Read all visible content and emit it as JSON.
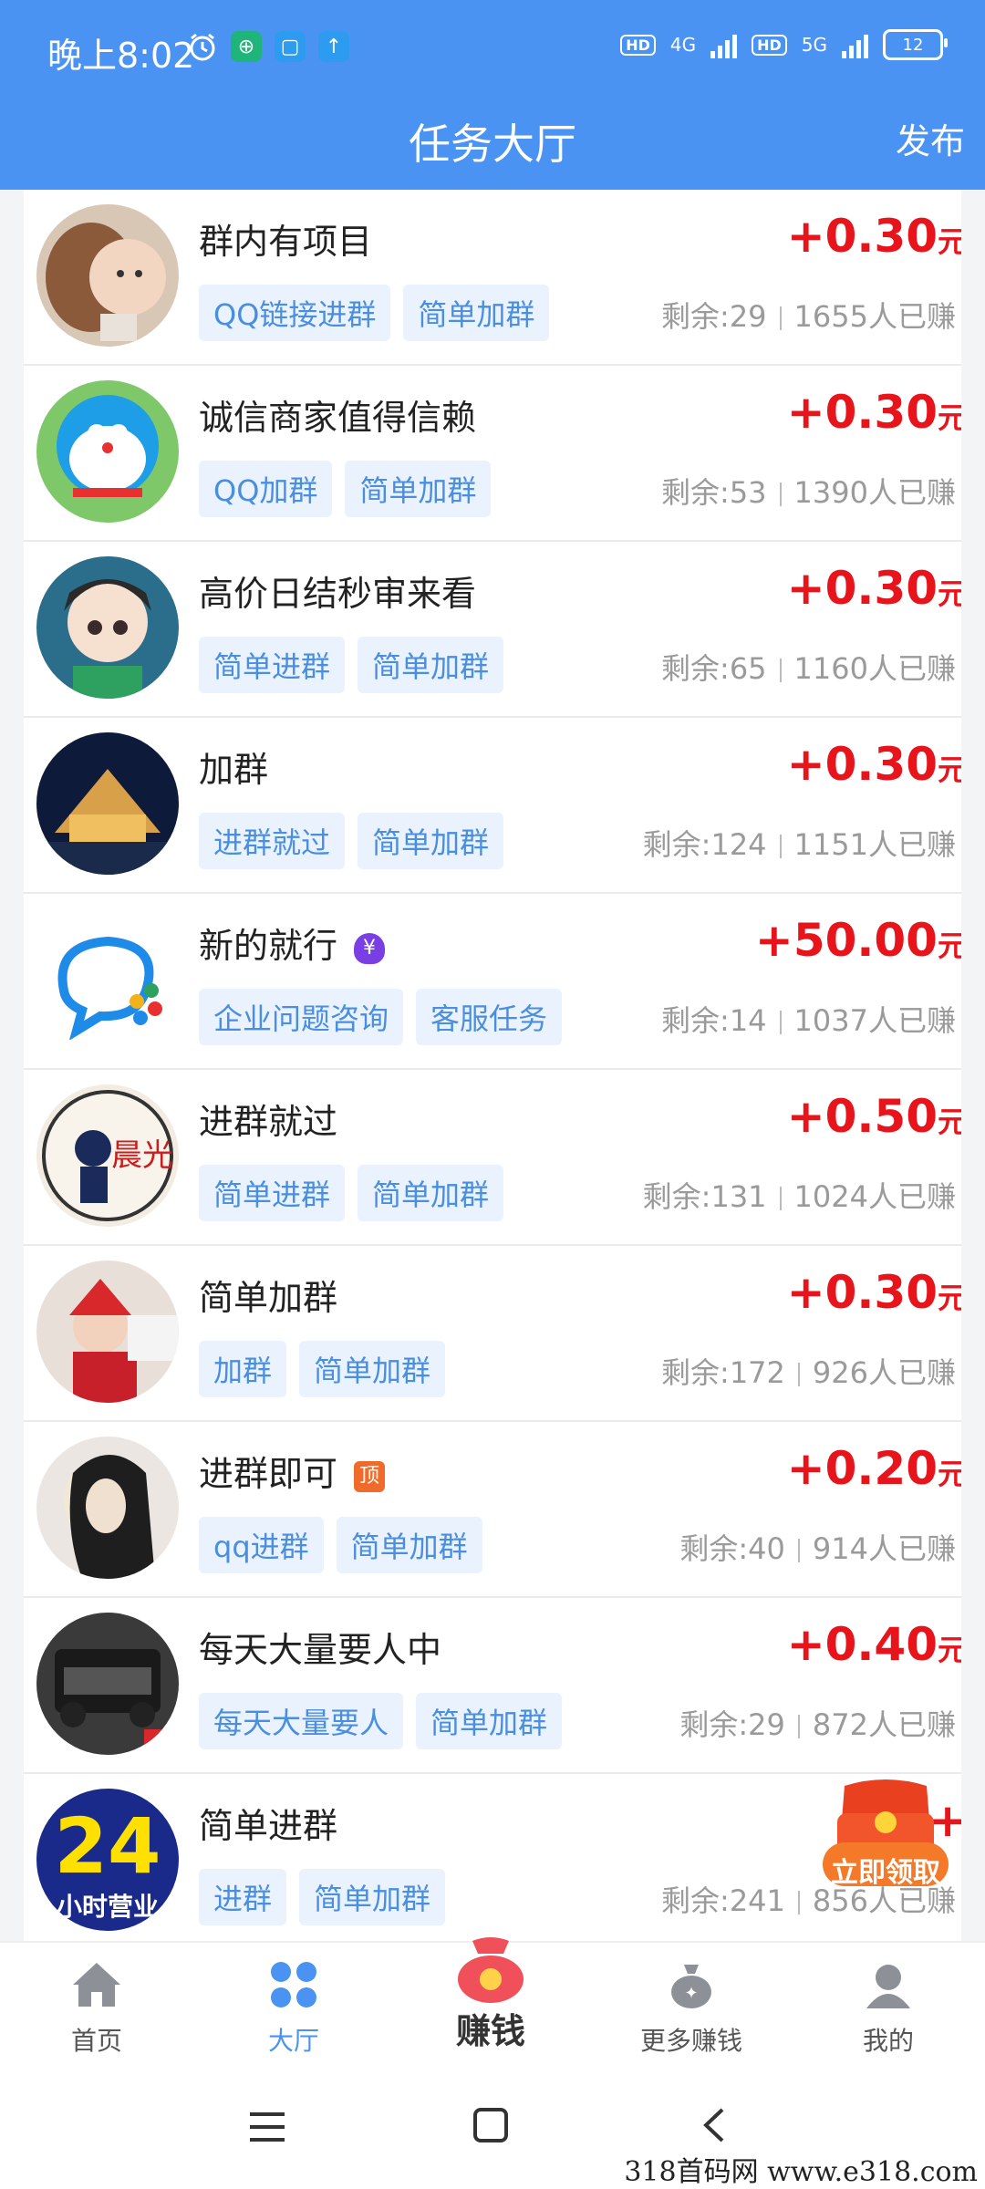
{
  "status_bar": {
    "time": "晚上8:02",
    "network_1": "4G",
    "network_2": "5G",
    "hd_1": "HD",
    "hd_2": "HD",
    "battery": "12"
  },
  "header": {
    "title": "任务大厅",
    "publish_label": "发布"
  },
  "tasks": [
    {
      "name": "群内有项目",
      "tags": [
        "QQ链接进群",
        "简单加群"
      ],
      "price": "+0.30",
      "unit": "元",
      "remaining": "剩余:29",
      "earned": "1655人已赚",
      "badge": ""
    },
    {
      "name": "诚信商家值得信赖",
      "tags": [
        "QQ加群",
        "简单加群"
      ],
      "price": "+0.30",
      "unit": "元",
      "remaining": "剩余:53",
      "earned": "1390人已赚",
      "badge": ""
    },
    {
      "name": "高价日结秒审来看",
      "tags": [
        "简单进群",
        "简单加群"
      ],
      "price": "+0.30",
      "unit": "元",
      "remaining": "剩余:65",
      "earned": "1160人已赚",
      "badge": ""
    },
    {
      "name": "加群",
      "tags": [
        "进群就过",
        "简单加群"
      ],
      "price": "+0.30",
      "unit": "元",
      "remaining": "剩余:124",
      "earned": "1151人已赚",
      "badge": ""
    },
    {
      "name": "新的就行",
      "tags": [
        "企业问题咨询",
        "客服任务"
      ],
      "price": "+50.00",
      "unit": "元",
      "remaining": "剩余:14",
      "earned": "1037人已赚",
      "badge": "¥"
    },
    {
      "name": "进群就过",
      "tags": [
        "简单进群",
        "简单加群"
      ],
      "price": "+0.50",
      "unit": "元",
      "remaining": "剩余:131",
      "earned": "1024人已赚",
      "badge": ""
    },
    {
      "name": "简单加群",
      "tags": [
        "加群",
        "简单加群"
      ],
      "price": "+0.30",
      "unit": "元",
      "remaining": "剩余:172",
      "earned": "926人已赚",
      "badge": ""
    },
    {
      "name": "进群即可",
      "tags": [
        "qq进群",
        "简单加群"
      ],
      "price": "+0.20",
      "unit": "元",
      "remaining": "剩余:40",
      "earned": "914人已赚",
      "badge": "顶"
    },
    {
      "name": "每天大量要人中",
      "tags": [
        "每天大量要人",
        "简单加群"
      ],
      "price": "+0.40",
      "unit": "元",
      "remaining": "剩余:29",
      "earned": "872人已赚",
      "badge": ""
    },
    {
      "name": "简单进群",
      "tags": [
        "进群",
        "简单加群"
      ],
      "price": "+",
      "unit": "",
      "remaining": "剩余:241",
      "earned": "856人已赚",
      "badge": ""
    }
  ],
  "avatar_text": {
    "row10_big": "24",
    "row10_small": "小时营业",
    "row6_calligraphy": "晨光"
  },
  "floating_gift": {
    "label": "立即领取"
  },
  "bottom_nav": {
    "home": "首页",
    "hall": "大厅",
    "earn": "赚钱",
    "more_earn": "更多赚钱",
    "mine": "我的"
  },
  "watermark": "318首码网  www.e318.com",
  "colors": {
    "brand_blue": "#4a93f2",
    "price_red": "#e8141b",
    "tag_bg": "#e9f2fd",
    "tag_text": "#4a8ee0"
  }
}
